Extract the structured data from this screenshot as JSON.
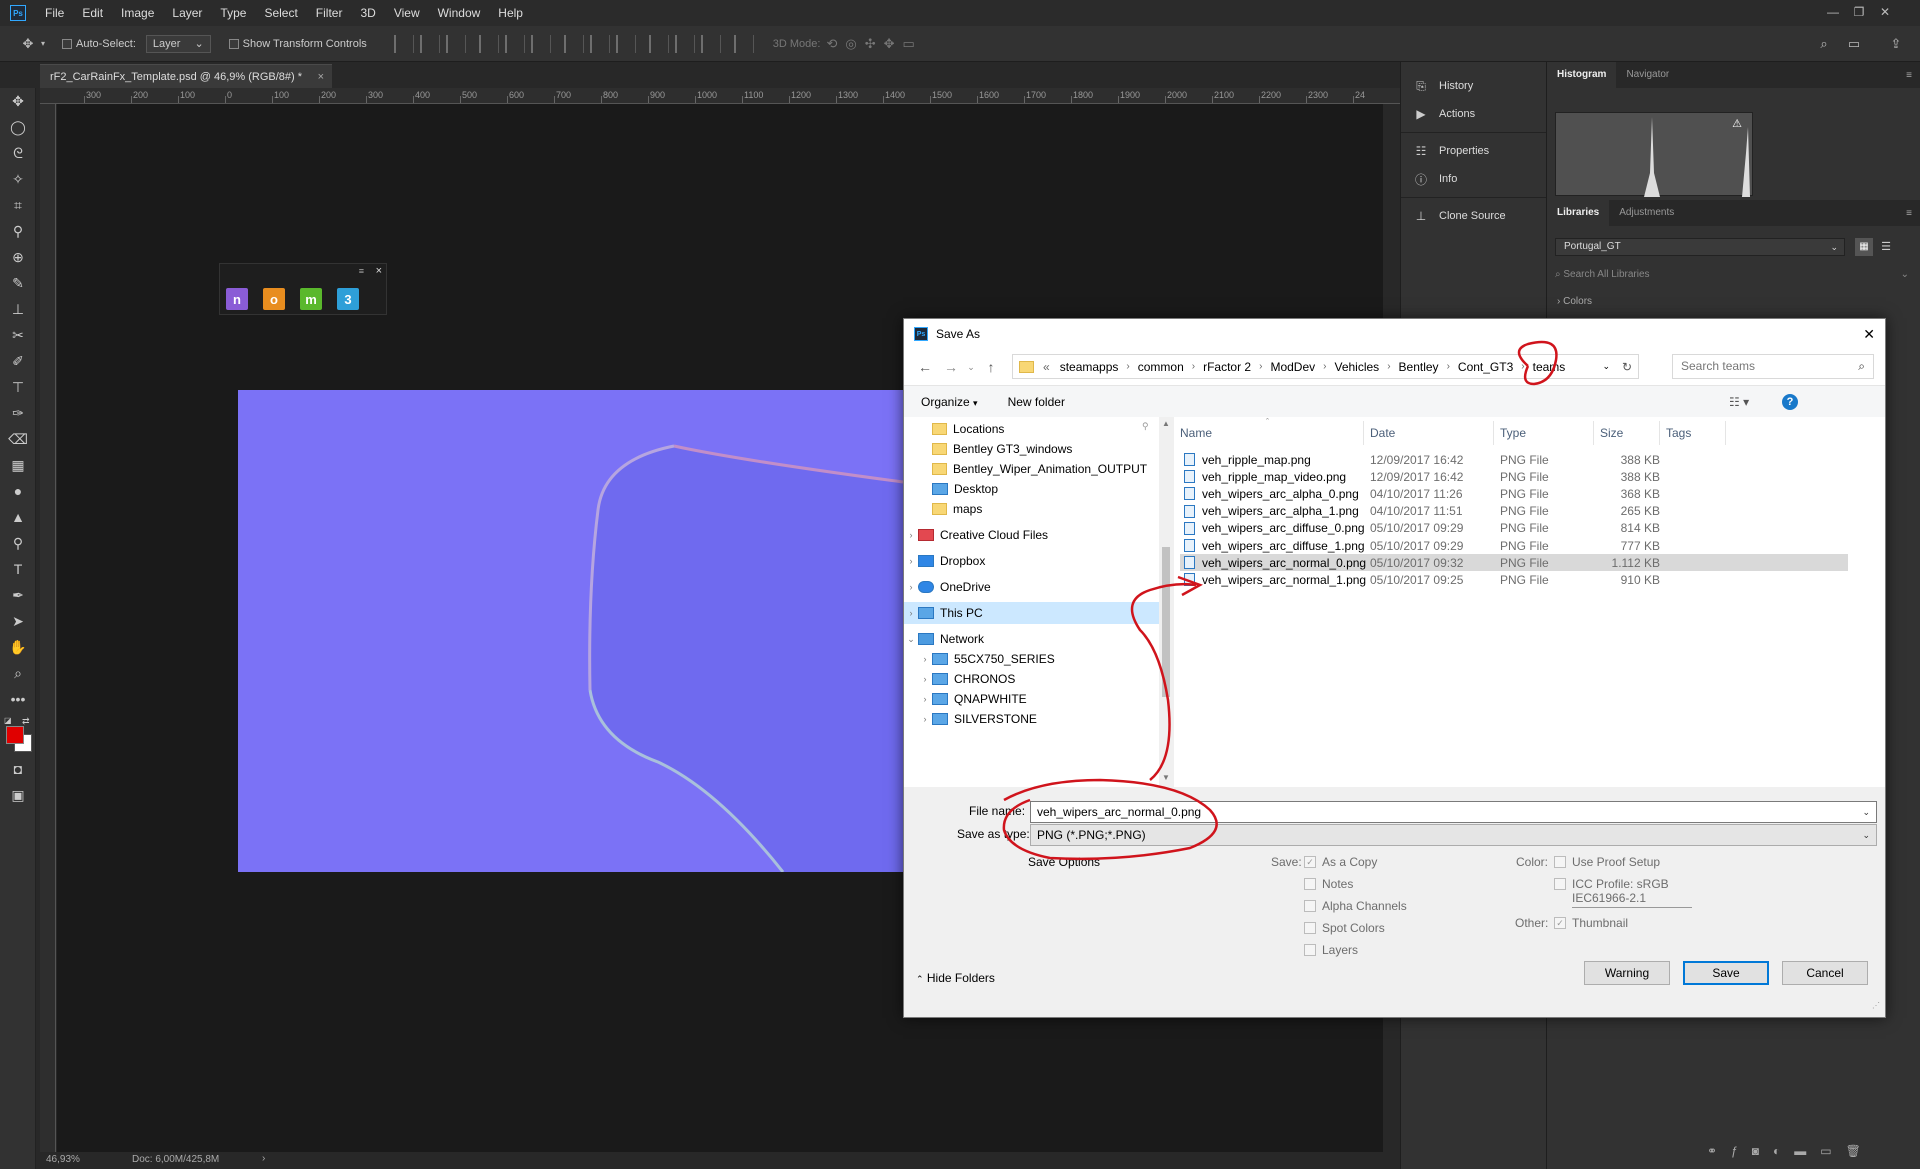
{
  "app": {
    "logo": "Ps",
    "menu": [
      "File",
      "Edit",
      "Image",
      "Layer",
      "Type",
      "Select",
      "Filter",
      "3D",
      "View",
      "Window",
      "Help"
    ],
    "window_controls": [
      "minimize-icon",
      "restore-icon",
      "close-icon"
    ]
  },
  "options": {
    "auto_select_label": "Auto-Select:",
    "auto_select_value": "Layer",
    "show_transform_label": "Show Transform Controls",
    "mode_3d_label": "3D Mode:"
  },
  "document": {
    "tab_title": "rF2_CarRainFx_Template.psd @ 46,9% (RGB/8#) *",
    "zoom": "46,93%",
    "doc_info": "Doc: 6,00M/425,8M",
    "ruler_labels": [
      "300",
      "200",
      "100",
      "0",
      "100",
      "200",
      "300",
      "400",
      "500",
      "600",
      "700",
      "800",
      "900",
      "1000",
      "1100",
      "1200",
      "1300",
      "1400",
      "1500",
      "1600",
      "1700",
      "1800",
      "1900",
      "2000",
      "2100",
      "2200",
      "2300",
      "24"
    ]
  },
  "floating_panel": {
    "icons": [
      {
        "glyph": "n",
        "color": "#8a5cd6"
      },
      {
        "glyph": "o",
        "color": "#e88d1f"
      },
      {
        "glyph": "m",
        "color": "#5ab82c"
      },
      {
        "glyph": "3",
        "color": "#2e9fd8"
      }
    ]
  },
  "dock": {
    "items": [
      "History",
      "Actions",
      "Properties",
      "Info",
      "Clone Source"
    ]
  },
  "panels": {
    "top_tabs": [
      "Histogram",
      "Navigator"
    ],
    "lib_tabs": [
      "Libraries",
      "Adjustments"
    ],
    "library_selected": "Portugal_GT",
    "library_search_placeholder": "Search All Libraries",
    "colors_label": "Colors"
  },
  "dialog": {
    "title": "Save As",
    "breadcrumb": [
      "steamapps",
      "common",
      "rFactor 2",
      "ModDev",
      "Vehicles",
      "Bentley",
      "Cont_GT3",
      "teams"
    ],
    "breadcrumb_prefix": "«",
    "search_placeholder": "Search teams",
    "organize_label": "Organize",
    "new_folder_label": "New folder",
    "nav_items": [
      {
        "label": "Locations",
        "type": "folder",
        "indent": 1
      },
      {
        "label": "Bentley GT3_windows",
        "type": "folder",
        "indent": 1
      },
      {
        "label": "Bentley_Wiper_Animation_OUTPUT",
        "type": "folder",
        "indent": 1
      },
      {
        "label": "Desktop",
        "type": "desktop",
        "indent": 1
      },
      {
        "label": "maps",
        "type": "folder",
        "indent": 1
      },
      {
        "label": "Creative Cloud Files",
        "type": "cc",
        "indent": 0
      },
      {
        "label": "Dropbox",
        "type": "dropbox",
        "indent": 0
      },
      {
        "label": "OneDrive",
        "type": "onedrive",
        "indent": 0
      },
      {
        "label": "This PC",
        "type": "pc",
        "indent": 0
      },
      {
        "label": "Network",
        "type": "network",
        "indent": 0
      },
      {
        "label": "55CX750_SERIES",
        "type": "pc",
        "indent": 1
      },
      {
        "label": "CHRONOS",
        "type": "pc",
        "indent": 1
      },
      {
        "label": "QNAPWHITE",
        "type": "pc",
        "indent": 1
      },
      {
        "label": "SILVERSTONE",
        "type": "pc",
        "indent": 1
      }
    ],
    "columns": [
      "Name",
      "Date",
      "Type",
      "Size",
      "Tags"
    ],
    "files": [
      {
        "name": "veh_ripple_map.png",
        "date": "12/09/2017 16:42",
        "type": "PNG File",
        "size": "388 KB"
      },
      {
        "name": "veh_ripple_map_video.png",
        "date": "12/09/2017 16:42",
        "type": "PNG File",
        "size": "388 KB"
      },
      {
        "name": "veh_wipers_arc_alpha_0.png",
        "date": "04/10/2017 11:26",
        "type": "PNG File",
        "size": "368 KB"
      },
      {
        "name": "veh_wipers_arc_alpha_1.png",
        "date": "04/10/2017 11:51",
        "type": "PNG File",
        "size": "265 KB"
      },
      {
        "name": "veh_wipers_arc_diffuse_0.png",
        "date": "05/10/2017 09:29",
        "type": "PNG File",
        "size": "814 KB"
      },
      {
        "name": "veh_wipers_arc_diffuse_1.png",
        "date": "05/10/2017 09:29",
        "type": "PNG File",
        "size": "777 KB"
      },
      {
        "name": "veh_wipers_arc_normal_0.png",
        "date": "05/10/2017 09:32",
        "type": "PNG File",
        "size": "1.112 KB"
      },
      {
        "name": "veh_wipers_arc_normal_1.png",
        "date": "05/10/2017 09:25",
        "type": "PNG File",
        "size": "910 KB"
      }
    ],
    "file_name_label": "File name:",
    "file_name_value": "veh_wipers_arc_normal_0.png",
    "save_type_label": "Save as type:",
    "save_type_value": "PNG (*.PNG;*.PNG)",
    "save_options_label": "Save Options",
    "save_label": "Save:",
    "save_opts": [
      "As a Copy",
      "Notes",
      "Alpha Channels",
      "Spot Colors",
      "Layers"
    ],
    "color_label": "Color:",
    "use_proof": "Use Proof Setup",
    "icc_profile": "ICC Profile:  sRGB",
    "icc_profile_2": "IEC61966-2.1",
    "other_label": "Other:",
    "thumbnail": "Thumbnail",
    "hide_folders": "Hide Folders",
    "buttons": {
      "warning": "Warning",
      "save": "Save",
      "cancel": "Cancel"
    }
  },
  "colors": {
    "accent_blue": "#0078d7",
    "annotation_red": "#d0141c",
    "canvas_fill": "#7b72f6",
    "foreground": "#e00000"
  }
}
